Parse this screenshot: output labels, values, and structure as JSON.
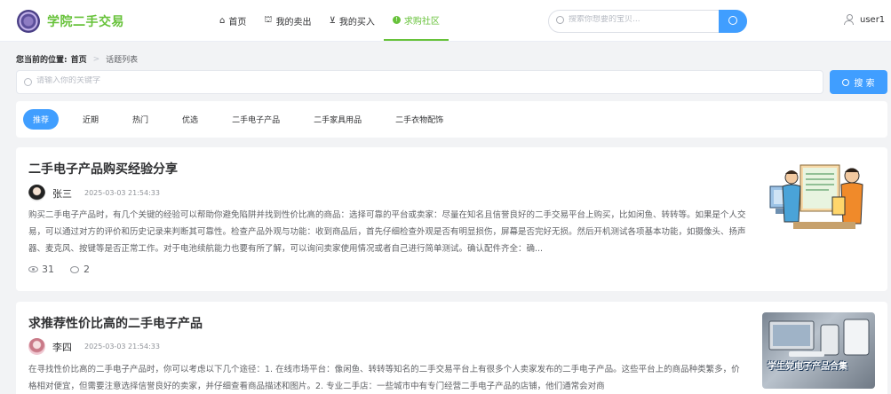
{
  "header": {
    "brand": "学院二手交易",
    "nav": [
      {
        "icon": "home-icon",
        "glyph": "⌂",
        "label": "首页"
      },
      {
        "icon": "shop-icon",
        "glyph": "⛫",
        "label": "我的卖出"
      },
      {
        "icon": "cart-icon",
        "glyph": "⊻",
        "label": "我的买入"
      },
      {
        "icon": "info-circle-icon",
        "glyph": "!",
        "label": "求购社区",
        "active": true
      }
    ],
    "search_placeholder": "搜索你想要的宝贝...",
    "username": "user1"
  },
  "breadcrumb": {
    "prefix": "您当前的位置:",
    "home": "首页",
    "current": "话题列表"
  },
  "keyword_search": {
    "placeholder": "请输入你的关键字",
    "button": "搜 索"
  },
  "tabs": [
    {
      "label": "推荐",
      "active": true
    },
    {
      "label": "近期"
    },
    {
      "label": "热门"
    },
    {
      "label": "优选"
    },
    {
      "label": "二手电子产品"
    },
    {
      "label": "二手家具用品"
    },
    {
      "label": "二手衣物配饰"
    }
  ],
  "posts": [
    {
      "title": "二手电子产品购买经验分享",
      "author": "张三",
      "time": "2025-03-03 21:54:33",
      "excerpt": "购买二手电子产品时，有几个关键的经验可以帮助你避免陷阱并找到性价比高的商品：选择可靠的平台或卖家：尽量在知名且信誉良好的二手交易平台上购买，比如闲鱼、转转等。如果是个人交易，可以通过对方的评价和历史记录来判断其可靠性。检查产品外观与功能：收到商品后，首先仔细检查外观是否有明显损伤，屏幕是否完好无损。然后开机测试各项基本功能，如摄像头、扬声器、麦克风、按键等是否正常工作。对于电池续航能力也要有所了解，可以询问卖家使用情况或者自己进行简单测试。确认配件齐全：确...",
      "views": "31",
      "comments": "2"
    },
    {
      "title": "求推荐性价比高的二手电子产品",
      "author": "李四",
      "time": "2025-03-03 21:54:33",
      "excerpt": "在寻找性价比高的二手电子产品时，你可以考虑以下几个途径：1. 在线市场平台：像闲鱼、转转等知名的二手交易平台上有很多个人卖家发布的二手电子产品。这些平台上的商品种类繁多，价格相对便宜，但需要注意选择信誉良好的卖家，并仔细查看商品描述和图片。2. 专业二手店：一些城市中有专门经营二手电子产品的店铺，他们通常会对商",
      "thumb_caption": "学生党电子产品合集"
    }
  ],
  "colors": {
    "brand": "#67c23a",
    "primary": "#409eff"
  }
}
